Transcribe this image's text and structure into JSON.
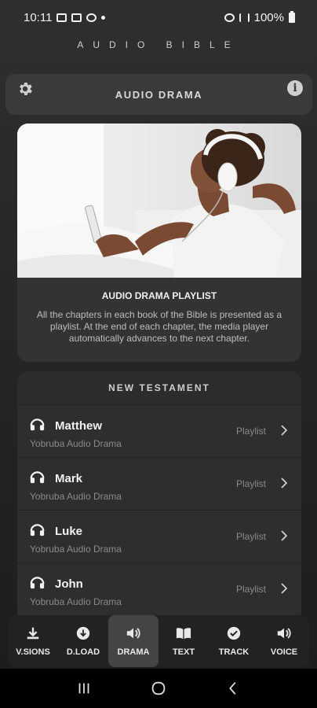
{
  "status_bar": {
    "time": "10:11",
    "battery": "100%"
  },
  "app_title": "AUDIO BIBLE",
  "header": {
    "title": "AUDIO DRAMA",
    "info_glyph": "i"
  },
  "hero": {
    "title": "AUDIO DRAMA PLAYLIST",
    "description": "All the chapters in each book of the Bible is presented as a playlist. At the end of each chapter, the media player automatically advances to the next chapter."
  },
  "testament": {
    "title": "NEW TESTAMENT",
    "books": [
      {
        "name": "Matthew",
        "subtitle": "Yobruba Audio Drama",
        "tag": "Playlist"
      },
      {
        "name": "Mark",
        "subtitle": "Yobruba Audio Drama",
        "tag": "Playlist"
      },
      {
        "name": "Luke",
        "subtitle": "Yobruba Audio Drama",
        "tag": "Playlist"
      },
      {
        "name": "John",
        "subtitle": "Yobruba Audio Drama",
        "tag": "Playlist"
      }
    ]
  },
  "bottom_nav": [
    {
      "label": "V.SIONS",
      "icon": "download-tray-icon"
    },
    {
      "label": "D.LOAD",
      "icon": "download-circle-icon"
    },
    {
      "label": "DRAMA",
      "icon": "speaker-icon",
      "active": true
    },
    {
      "label": "TEXT",
      "icon": "book-icon"
    },
    {
      "label": "TRACK",
      "icon": "check-circle-icon"
    },
    {
      "label": "VOICE",
      "icon": "speaker-icon"
    }
  ],
  "colors": {
    "background": "#2a2a2a",
    "card": "#3a3a3a",
    "active_nav": "#444444"
  }
}
